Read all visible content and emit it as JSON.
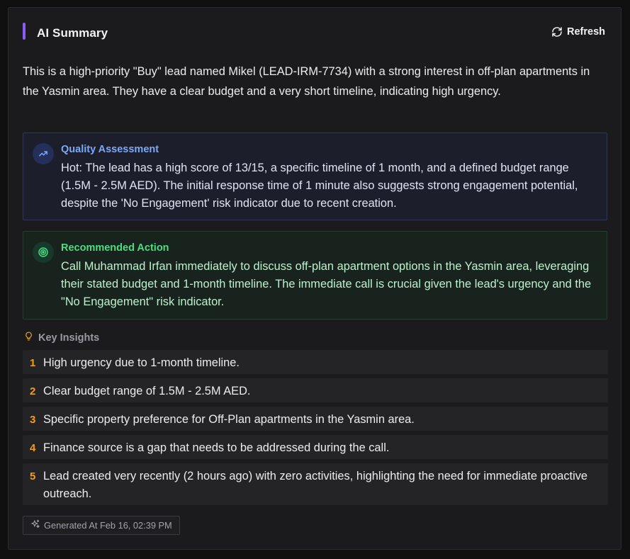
{
  "header": {
    "title": "AI Summary",
    "refresh_label": "Refresh"
  },
  "summary": "This is a high-priority \"Buy\" lead named Mikel (LEAD-IRM-7734) with a strong interest in off-plan apartments in the Yasmin area. They have a clear budget and a very short timeline, indicating high urgency.",
  "quality": {
    "title": "Quality Assessment",
    "text": "Hot: The lead has a high score of 13/15, a specific timeline of 1 month, and a defined budget range (1.5M - 2.5M AED). The initial response time of 1 minute also suggests strong engagement potential, despite the 'No Engagement' risk indicator due to recent creation.",
    "icon": "trending-up-icon"
  },
  "action": {
    "title": "Recommended Action",
    "text": "Call Muhammad Irfan immediately to discuss off-plan apartment options in the Yasmin area, leveraging their stated budget and 1-month timeline. The immediate call is crucial given the lead's urgency and the \"No Engagement\" risk indicator.",
    "icon": "target-icon"
  },
  "insights": {
    "title": "Key Insights",
    "icon": "lightbulb-icon",
    "items": [
      {
        "num": "1",
        "text": "High urgency due to 1-month timeline."
      },
      {
        "num": "2",
        "text": "Clear budget range of 1.5M - 2.5M AED."
      },
      {
        "num": "3",
        "text": "Specific property preference for Off-Plan apartments in the Yasmin area."
      },
      {
        "num": "4",
        "text": "Finance source is a gap that needs to be addressed during the call."
      },
      {
        "num": "5",
        "text": "Lead created very recently (2 hours ago) with zero activities, highlighting the need for immediate proactive outreach."
      }
    ]
  },
  "footer": {
    "generated_label": "Generated At Feb 16, 02:39 PM",
    "icon": "sparkles-icon"
  },
  "colors": {
    "accent": "#8b5cf6",
    "quality_title": "#7ea8f5",
    "action_title": "#4ade80",
    "insight_number": "#f59e0b"
  }
}
